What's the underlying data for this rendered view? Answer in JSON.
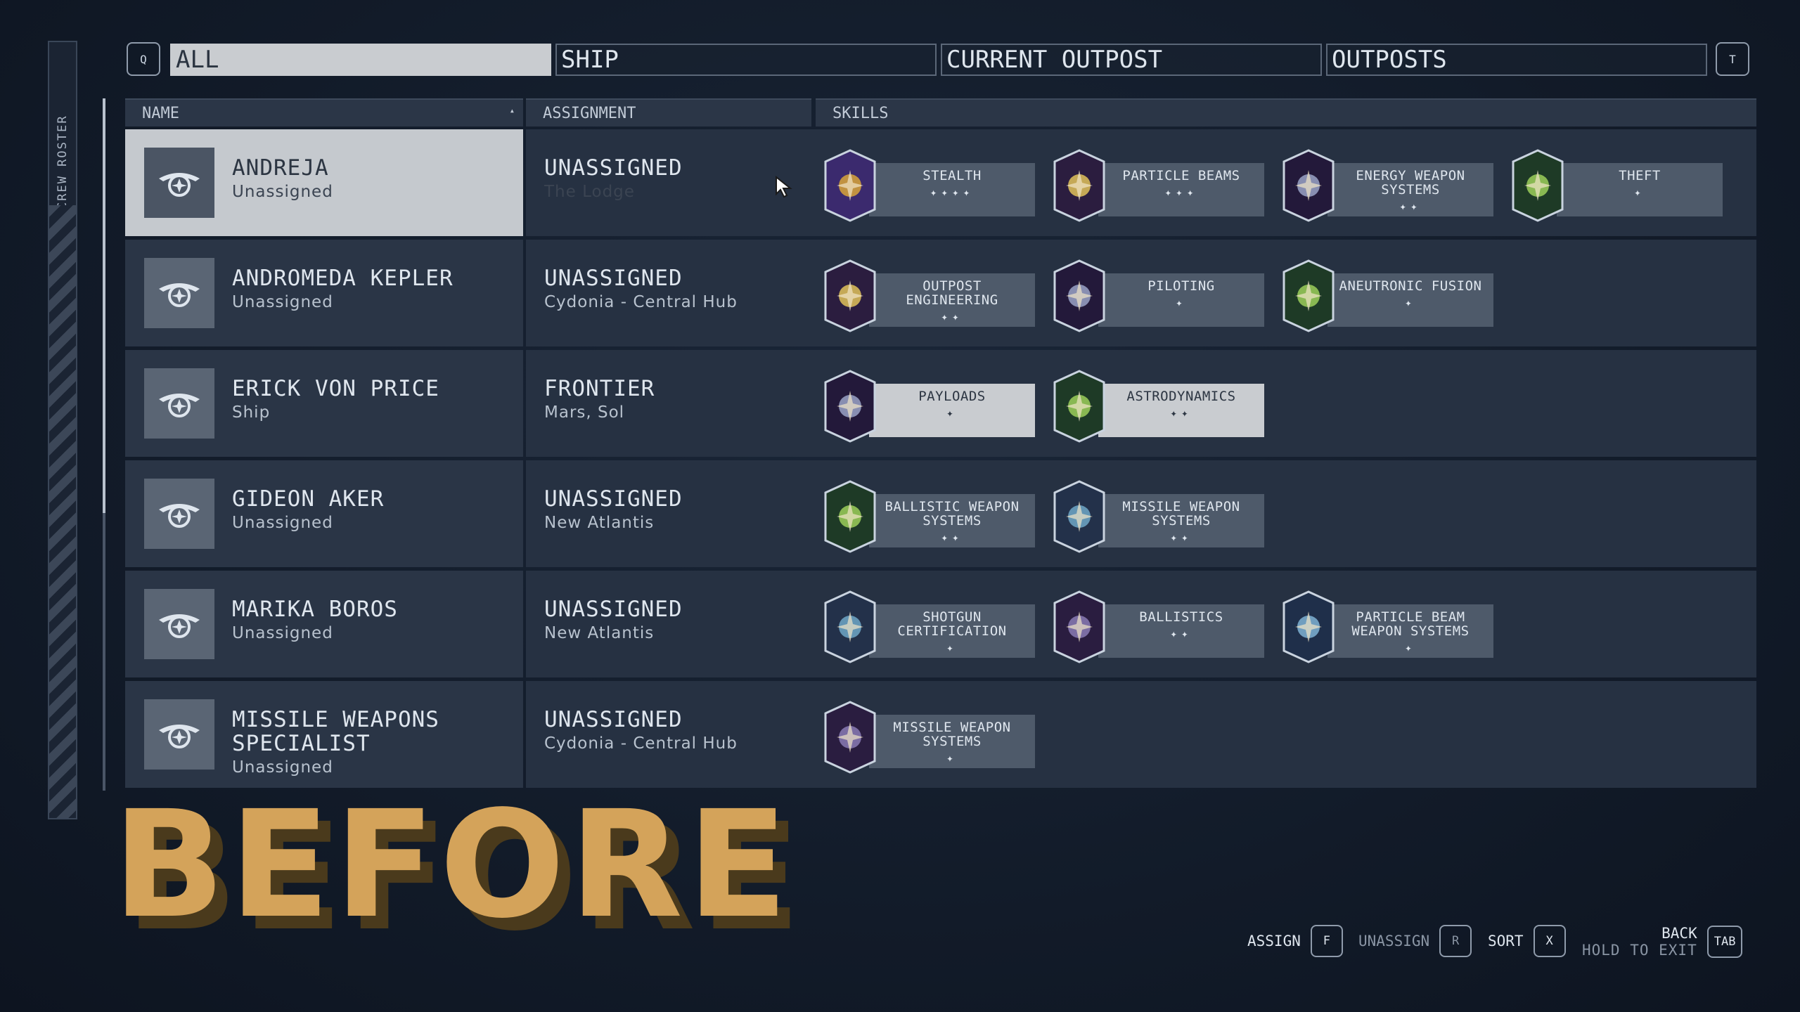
{
  "side_tab": {
    "label": "CREW ROSTER"
  },
  "tabs": {
    "left_key": "Q",
    "right_key": "T",
    "items": [
      {
        "label": "ALL",
        "active": true
      },
      {
        "label": "SHIP",
        "active": false
      },
      {
        "label": "CURRENT OUTPOST",
        "active": false
      },
      {
        "label": "OUTPOSTS",
        "active": false
      }
    ]
  },
  "table": {
    "headers": {
      "name": "NAME",
      "assignment": "ASSIGNMENT",
      "skills": "SKILLS"
    },
    "rows": [
      {
        "name": "ANDREJA",
        "status": "Unassigned",
        "assignment": "UNASSIGNED",
        "location": "The Lodge",
        "skills": [
          {
            "name": "STEALTH",
            "rank": "✦✦✦✦",
            "icon": "stealth-icon"
          },
          {
            "name": "PARTICLE BEAMS",
            "rank": "✦✦✦",
            "icon": "particle-beams-icon"
          },
          {
            "name": "ENERGY WEAPON SYSTEMS",
            "rank": "✦✦",
            "icon": "energy-weapon-systems-icon"
          },
          {
            "name": "THEFT",
            "rank": "✦",
            "icon": "theft-icon"
          }
        ]
      },
      {
        "name": "ANDROMEDA KEPLER",
        "status": "Unassigned",
        "assignment": "UNASSIGNED",
        "location": "Cydonia - Central Hub",
        "skills": [
          {
            "name": "OUTPOST ENGINEERING",
            "rank": "✦✦",
            "icon": "outpost-engineering-icon"
          },
          {
            "name": "PILOTING",
            "rank": "✦",
            "icon": "piloting-icon"
          },
          {
            "name": "ANEUTRONIC FUSION",
            "rank": "✦",
            "icon": "aneutronic-fusion-icon"
          }
        ]
      },
      {
        "name": "ERICK VON PRICE",
        "status": "Ship",
        "assignment": "FRONTIER",
        "location": "Mars, Sol",
        "skills": [
          {
            "name": "PAYLOADS",
            "rank": "✦",
            "icon": "payloads-icon"
          },
          {
            "name": "ASTRODYNAMICS",
            "rank": "✦✦",
            "icon": "astrodynamics-icon"
          }
        ]
      },
      {
        "name": "GIDEON AKER",
        "status": "Unassigned",
        "assignment": "UNASSIGNED",
        "location": "New Atlantis",
        "skills": [
          {
            "name": "BALLISTIC WEAPON SYSTEMS",
            "rank": "✦✦",
            "icon": "ballistic-weapon-systems-icon"
          },
          {
            "name": "MISSILE WEAPON SYSTEMS",
            "rank": "✦✦",
            "icon": "missile-weapon-systems-icon"
          }
        ]
      },
      {
        "name": "MARIKA BOROS",
        "status": "Unassigned",
        "assignment": "UNASSIGNED",
        "location": "New Atlantis",
        "skills": [
          {
            "name": "SHOTGUN CERTIFICATION",
            "rank": "✦",
            "icon": "shotgun-certification-icon"
          },
          {
            "name": "BALLISTICS",
            "rank": "✦✦",
            "icon": "ballistics-icon"
          },
          {
            "name": "PARTICLE BEAM WEAPON SYSTEMS",
            "rank": "✦",
            "icon": "particle-beam-weapon-systems-icon"
          }
        ]
      },
      {
        "name": "MISSILE WEAPONS SPECIALIST",
        "status": "Unassigned",
        "assignment": "UNASSIGNED",
        "location": "Cydonia - Central Hub",
        "skills": [
          {
            "name": "MISSILE WEAPON SYSTEMS",
            "rank": "✦",
            "icon": "missile-weapon-systems-icon"
          }
        ]
      }
    ]
  },
  "overlay_text": "BEFORE",
  "hints": {
    "assign_label": "ASSIGN",
    "assign_key": "F",
    "unassign_label": "UNASSIGN",
    "unassign_key": "R",
    "sort_label": "SORT",
    "sort_key": "X",
    "back_label": "BACK",
    "hold_label": "HOLD TO EXIT",
    "back_key": "TAB"
  }
}
